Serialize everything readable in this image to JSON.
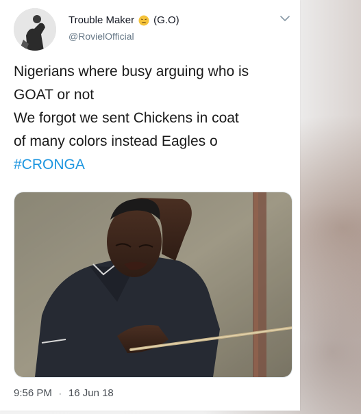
{
  "tweet": {
    "display_name": "Trouble Maker",
    "name_suffix": "(G.O)",
    "handle": "@RovielOfficial",
    "text_lines": [
      "Nigerians where busy arguing who is",
      "GOAT or not",
      "We forgot we sent Chickens in coat",
      "of many colors instead Eagles o"
    ],
    "hashtag": "#CRONGA",
    "time": "9:56 PM",
    "separator": "·",
    "date": "16 Jun 18"
  },
  "icons": {
    "menu": "chevron-down-icon",
    "emoji": "disappointed-face-icon"
  },
  "colors": {
    "link": "#1b95e0",
    "secondary_text": "#657786",
    "primary_text": "#1a1a1a"
  }
}
